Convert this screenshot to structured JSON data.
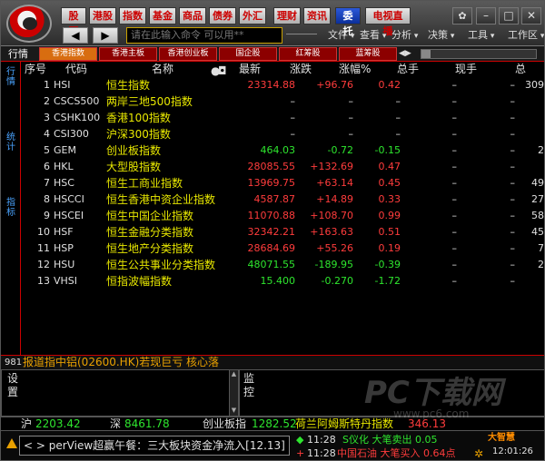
{
  "toolbar": {
    "menu_buttons": [
      "股票",
      "港股",
      "指数",
      "基金",
      "商品",
      "债券",
      "外汇",
      "理财",
      "资讯",
      "委托",
      "电视直播"
    ],
    "active_button": "委托",
    "command_placeholder": "请在此输入命令  可以用**",
    "menus": [
      "文件",
      "查看",
      "分析",
      "决策",
      "工具",
      "工作区"
    ]
  },
  "tabs": {
    "head_label": "行情",
    "items": [
      "香港指数",
      "香港主板",
      "香港创业板",
      "国企股",
      "红筹股",
      "蓝筹股"
    ],
    "active": "香港指数"
  },
  "side_tabs": [
    "行情",
    "统计",
    "指标"
  ],
  "table": {
    "headers": [
      "序号",
      "代码",
      "名称",
      "最新",
      "涨跌",
      "涨幅%",
      "总手",
      "现手",
      "总"
    ],
    "rows": [
      {
        "no": "1",
        "code": "HSI",
        "name": "恒生指数",
        "last": "23314.88",
        "chg": "+96.76",
        "pct": "0.42",
        "vol": "–",
        "cur": "–",
        "tot": "309",
        "dir": "up"
      },
      {
        "no": "2",
        "code": "CSCS500",
        "name": "两岸三地500指数",
        "last": "–",
        "chg": "–",
        "pct": "–",
        "vol": "–",
        "cur": "–",
        "tot": "",
        "dir": "flat"
      },
      {
        "no": "3",
        "code": "CSHK100",
        "name": "香港100指数",
        "last": "–",
        "chg": "–",
        "pct": "–",
        "vol": "–",
        "cur": "–",
        "tot": "",
        "dir": "flat"
      },
      {
        "no": "4",
        "code": "CSI300",
        "name": "沪深300指数",
        "last": "–",
        "chg": "–",
        "pct": "–",
        "vol": "–",
        "cur": "–",
        "tot": "",
        "dir": "flat"
      },
      {
        "no": "5",
        "code": "GEM",
        "name": "创业板指数",
        "last": "464.03",
        "chg": "-0.72",
        "pct": "-0.15",
        "vol": "–",
        "cur": "–",
        "tot": "2",
        "dir": "dn"
      },
      {
        "no": "6",
        "code": "HKL",
        "name": "大型股指数",
        "last": "28085.55",
        "chg": "+132.69",
        "pct": "0.47",
        "vol": "–",
        "cur": "–",
        "tot": "",
        "dir": "up"
      },
      {
        "no": "7",
        "code": "HSC",
        "name": "恒生工商业指数",
        "last": "13969.75",
        "chg": "+63.14",
        "pct": "0.45",
        "vol": "–",
        "cur": "–",
        "tot": "49",
        "dir": "up"
      },
      {
        "no": "8",
        "code": "HSCCI",
        "name": "恒生香港中资企业指数",
        "last": "4587.87",
        "chg": "+14.89",
        "pct": "0.33",
        "vol": "–",
        "cur": "–",
        "tot": "27",
        "dir": "up"
      },
      {
        "no": "9",
        "code": "HSCEI",
        "name": "恒生中国企业指数",
        "last": "11070.88",
        "chg": "+108.70",
        "pct": "0.99",
        "vol": "–",
        "cur": "–",
        "tot": "58",
        "dir": "up"
      },
      {
        "no": "10",
        "code": "HSF",
        "name": "恒生金融分类指数",
        "last": "32342.21",
        "chg": "+163.63",
        "pct": "0.51",
        "vol": "–",
        "cur": "–",
        "tot": "45",
        "dir": "up"
      },
      {
        "no": "11",
        "code": "HSP",
        "name": "恒生地产分类指数",
        "last": "28684.69",
        "chg": "+55.26",
        "pct": "0.19",
        "vol": "–",
        "cur": "–",
        "tot": "7",
        "dir": "up"
      },
      {
        "no": "12",
        "code": "HSU",
        "name": "恒生公共事业分类指数",
        "last": "48071.55",
        "chg": "-189.95",
        "pct": "-0.39",
        "vol": "–",
        "cur": "–",
        "tot": "2",
        "dir": "dn"
      },
      {
        "no": "13",
        "code": "VHSI",
        "name": "恒指波幅指数",
        "last": "15.400",
        "chg": "-0.270",
        "pct": "-1.72",
        "vol": "–",
        "cur": "–",
        "tot": "",
        "dir": "dn"
      }
    ]
  },
  "ticker": {
    "count": "981",
    "text": "报道指中铝(02600.HK)若现巨亏 核心落"
  },
  "panels": {
    "left_label": "设置",
    "right_label": "监控"
  },
  "index_strip": {
    "sh_label": "沪",
    "sh_value": "2203.42",
    "sz_label": "深",
    "sz_value": "8461.78",
    "gem_label": "创业板指",
    "gem_value": "1282.52",
    "extra_label": "荷兰阿姆斯特丹指数",
    "extra_value": "346.13"
  },
  "news": {
    "text": "< > perView超赢午餐：三大板块资金净流入[12.13]"
  },
  "alerts": [
    {
      "time": "11:28",
      "text": "S仪化 大笔卖出 0.05"
    },
    {
      "time": "11:28",
      "text": "中国石油 大笔买入 0.64点"
    }
  ],
  "status": {
    "brand": "大智慧",
    "clock": "12:01:26"
  },
  "watermark": {
    "text": "PC下载网",
    "url": "www.pc6.com"
  },
  "colors": {
    "up": "#ff3c3c",
    "down": "#2ee52e",
    "name": "#e8e800",
    "accent": "#c00000",
    "tab_active": "#d86d10"
  }
}
